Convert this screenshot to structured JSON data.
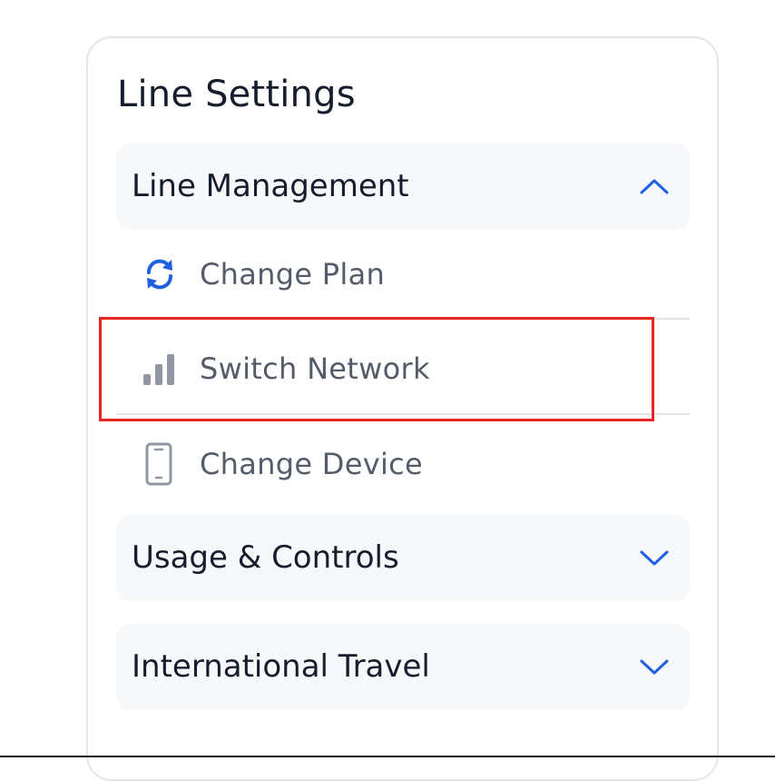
{
  "panel": {
    "title": "Line Settings"
  },
  "sections": [
    {
      "label": "Line Management",
      "expanded": true,
      "chevron_icon": "chevron-up-icon"
    },
    {
      "label": "Usage & Controls",
      "expanded": false,
      "chevron_icon": "chevron-down-icon"
    },
    {
      "label": "International Travel",
      "expanded": false,
      "chevron_icon": "chevron-down-icon"
    }
  ],
  "line_management_items": [
    {
      "label": "Change Plan",
      "icon": "refresh-icon"
    },
    {
      "label": "Switch Network",
      "icon": "signal-bars-icon"
    },
    {
      "label": "Change Device",
      "icon": "phone-icon"
    }
  ],
  "colors": {
    "accent": "#1f5fe0",
    "highlight_border": "#e8261f",
    "section_bg": "#f7f8fa",
    "heading_text": "#161e2e",
    "item_text": "#545c6a",
    "icon_gray": "#9097a2"
  }
}
